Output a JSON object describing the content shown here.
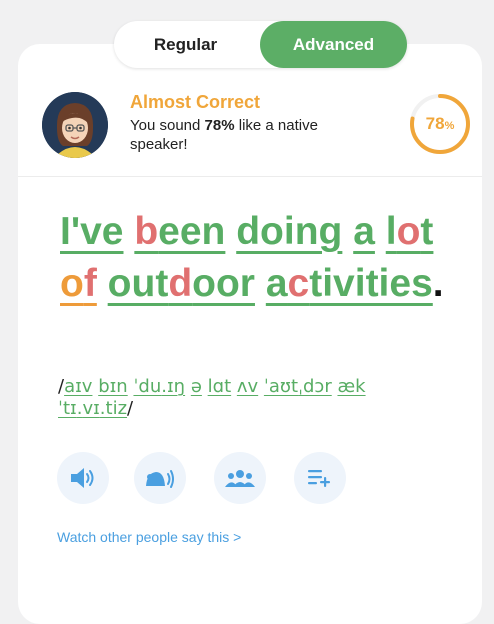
{
  "tabs": {
    "regular": "Regular",
    "advanced": "Advanced"
  },
  "feedback": {
    "status": "Almost Correct",
    "desc_prefix": "You sound ",
    "desc_percent": "78%",
    "desc_suffix": " like a native speaker!",
    "score_value": "78",
    "score_unit": "%",
    "score_fraction": 0.78
  },
  "sentence": {
    "w1": "I've",
    "w2a": "b",
    "w2b": "een",
    "w3": "doing",
    "w4": "a",
    "w5a": "l",
    "w5b": "o",
    "w5c": "t",
    "w6a": "o",
    "w6b": "f",
    "w7a": "out",
    "w7b": "d",
    "w7c": "oor",
    "w8a": "a",
    "w8b": "c",
    "w8c": "tivities",
    "end": "."
  },
  "ipa": {
    "open": "/",
    "i1": "aɪv",
    "i2": "bɪn",
    "i3a": "ˈdu",
    "i3b": ".",
    "i3c": "ɪŋ",
    "i4": "ə",
    "i5": "lɑt",
    "i6": "ʌv",
    "i7a": "ˈaʊt",
    "i7b": "ˌdɔr",
    "i8a": "æk",
    "i8b": "ˈtɪ",
    "i8c": ".",
    "i8d": "vɪ",
    "i8e": ".",
    "i8f": "tiz",
    "close": "/"
  },
  "actions": {
    "icons": [
      "speaker-icon",
      "slow-playback-icon",
      "group-icon",
      "add-to-list-icon"
    ]
  },
  "watch_link": "Watch other people say this >",
  "colors": {
    "green": "#58ad64",
    "red": "#e07070",
    "orange": "#ee9b3a",
    "accent_blue": "#4a9fe0"
  }
}
